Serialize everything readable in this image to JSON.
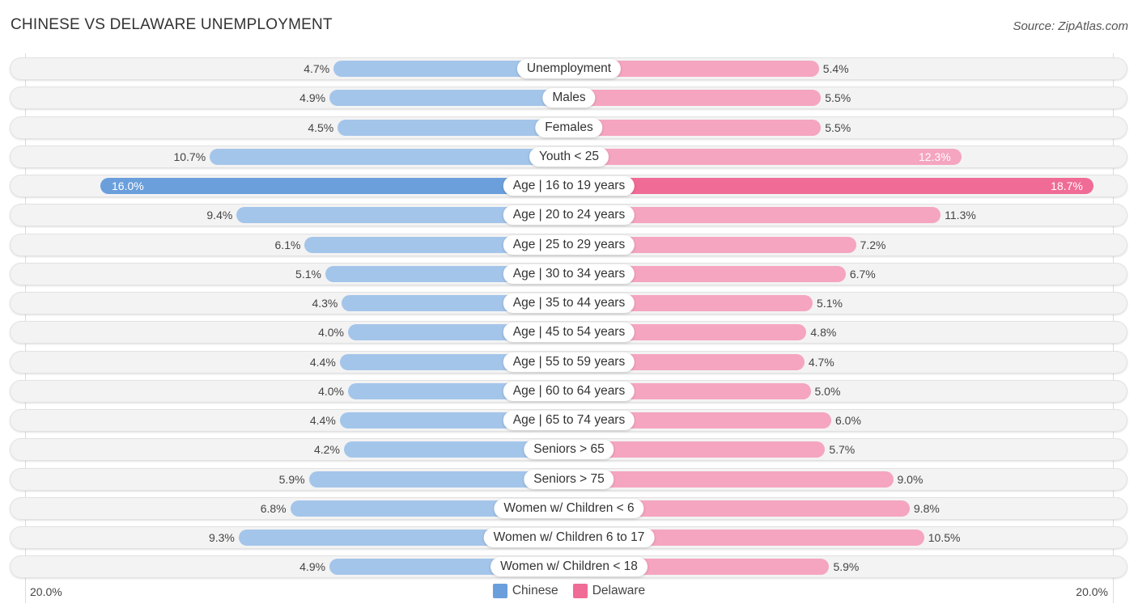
{
  "title": "CHINESE VS DELAWARE UNEMPLOYMENT",
  "source": "Source: ZipAtlas.com",
  "chart_data": {
    "type": "bar",
    "orientation": "horizontal-diverging",
    "title": "CHINESE VS DELAWARE UNEMPLOYMENT",
    "categories": [
      "Unemployment",
      "Males",
      "Females",
      "Youth < 25",
      "Age | 16 to 19 years",
      "Age | 20 to 24 years",
      "Age | 25 to 29 years",
      "Age | 30 to 34 years",
      "Age | 35 to 44 years",
      "Age | 45 to 54 years",
      "Age | 55 to 59 years",
      "Age | 60 to 64 years",
      "Age | 65 to 74 years",
      "Seniors > 65",
      "Seniors > 75",
      "Women w/ Children < 6",
      "Women w/ Children 6 to 17",
      "Women w/ Children < 18"
    ],
    "series": [
      {
        "name": "Chinese",
        "color": "#6a9fdc",
        "side": "left",
        "values": [
          4.7,
          4.9,
          4.5,
          10.7,
          16.0,
          9.4,
          6.1,
          5.1,
          4.3,
          4.0,
          4.4,
          4.0,
          4.4,
          4.2,
          5.9,
          6.8,
          9.3,
          4.9
        ]
      },
      {
        "name": "Delaware",
        "color": "#f06b96",
        "side": "right",
        "values": [
          5.4,
          5.5,
          5.5,
          12.3,
          18.7,
          11.3,
          7.2,
          6.7,
          5.1,
          4.8,
          4.7,
          5.0,
          6.0,
          5.7,
          9.0,
          9.8,
          10.5,
          5.9
        ]
      }
    ],
    "value_suffix": "%",
    "axis": {
      "left_label": "20.0%",
      "right_label": "20.0%",
      "max": 20.0
    },
    "legend": {
      "position": "bottom-center",
      "items": [
        "Chinese",
        "Delaware"
      ]
    }
  }
}
